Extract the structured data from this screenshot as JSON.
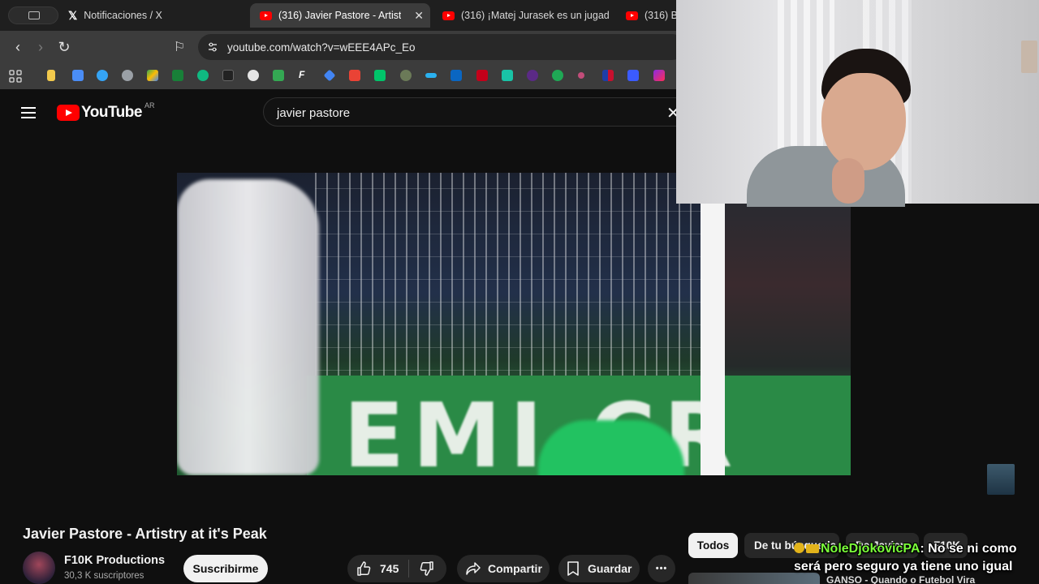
{
  "browser": {
    "tabs": [
      {
        "label": "Notificaciones / X",
        "icon": "x-logo-icon"
      },
      {
        "label": "(316) Javier Pastore - Artist",
        "icon": "youtube-icon",
        "active": true
      },
      {
        "label": "(316) ¡Matej Jurasek es un jugad",
        "icon": "youtube-icon"
      },
      {
        "label": "(316) B",
        "icon": "youtube-icon"
      }
    ],
    "url": "youtube.com/watch?v=wEEE4APc_Eo"
  },
  "youtube": {
    "logo_text": "YouTube",
    "country_code": "AR",
    "search_query": "javier pastore",
    "video_title": "Javier Pastore - Artistry at it's Peak",
    "channel_name": "F10K Productions",
    "subscribers": "30,3 K suscriptores",
    "subscribe_label": "Suscribirme",
    "likes": "745",
    "share_label": "Compartir",
    "save_label": "Guardar",
    "more_label": "•••",
    "chips": [
      "Todos",
      "De tu búsqueda",
      "De Javier",
      "F10K"
    ],
    "reco_title": "GANSO - Quando o Futebol Vira"
  },
  "chat": {
    "username": "NoleDjokovicPA",
    "message": ": No se ni como será pero seguro ya tiene uno igual"
  },
  "colors": {
    "accent": "#ff0000",
    "chat_user": "#7bff3a",
    "background": "#0f0f0f"
  }
}
